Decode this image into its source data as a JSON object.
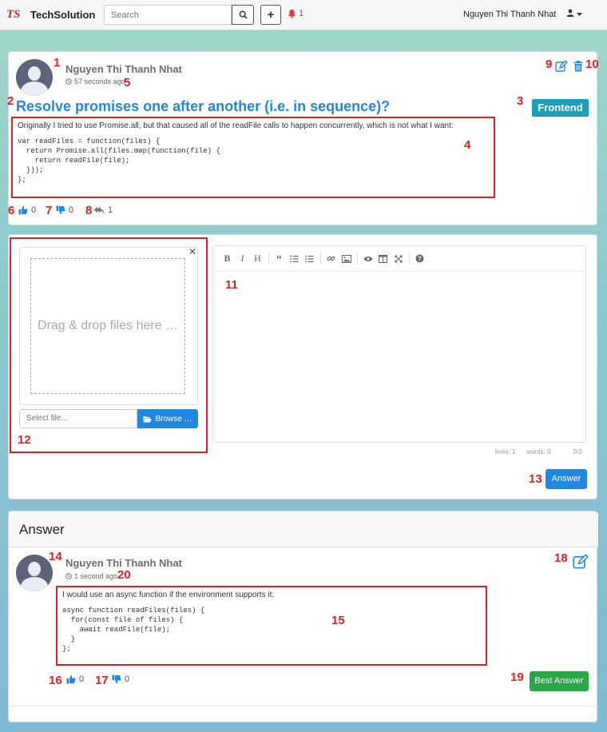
{
  "navbar": {
    "logo_mark": "TS",
    "brand": "TechSolution",
    "search_placeholder": "Search",
    "notification_count": "1",
    "user_name": "Nguyen Thi Thanh Nhat"
  },
  "question": {
    "author": "Nguyen Thi Thanh Nhat",
    "time": "57 seconds ago",
    "title": "Resolve promises one after another (i.e. in sequence)?",
    "tag": "Frontend",
    "body_text": "Originally I tried to use Promise.all, but that caused all of the readFile calls to happen concurrently, which is not what I want:",
    "code": "var readFiles = function(files) {\n  return Promise.all(files.map(function(file) {\n    return readFile(file);\n  }));\n};",
    "likes": "0",
    "dislikes": "0",
    "replies": "1"
  },
  "editor": {
    "drop_text": "Drag & drop files here …",
    "file_placeholder": "Select file...",
    "browse_label": "Browse …",
    "status_lines": "lines: 1",
    "status_words": "words: 0",
    "status_cursor": "0:0",
    "submit_label": "Answer"
  },
  "answers": {
    "heading": "Answer",
    "items": [
      {
        "author": "Nguyen Thi Thanh Nhat",
        "time": "1 second ago",
        "body_text": "I would use an async function if the environment supports it:",
        "code": "async function readFiles(files) {\n  for(const file of files) {\n    await readFile(file);\n  }\n};",
        "likes": "0",
        "dislikes": "0",
        "best_label": "Best Answer"
      }
    ]
  },
  "annotations": [
    "1",
    "2",
    "3",
    "4",
    "5",
    "6",
    "7",
    "8",
    "9",
    "10",
    "11",
    "12",
    "13",
    "14",
    "15",
    "16",
    "17",
    "18",
    "19",
    "20"
  ],
  "colors": {
    "accent": "#1e88e5",
    "tag": "#17a2b8",
    "success": "#28a745",
    "annotation": "#e02020"
  }
}
